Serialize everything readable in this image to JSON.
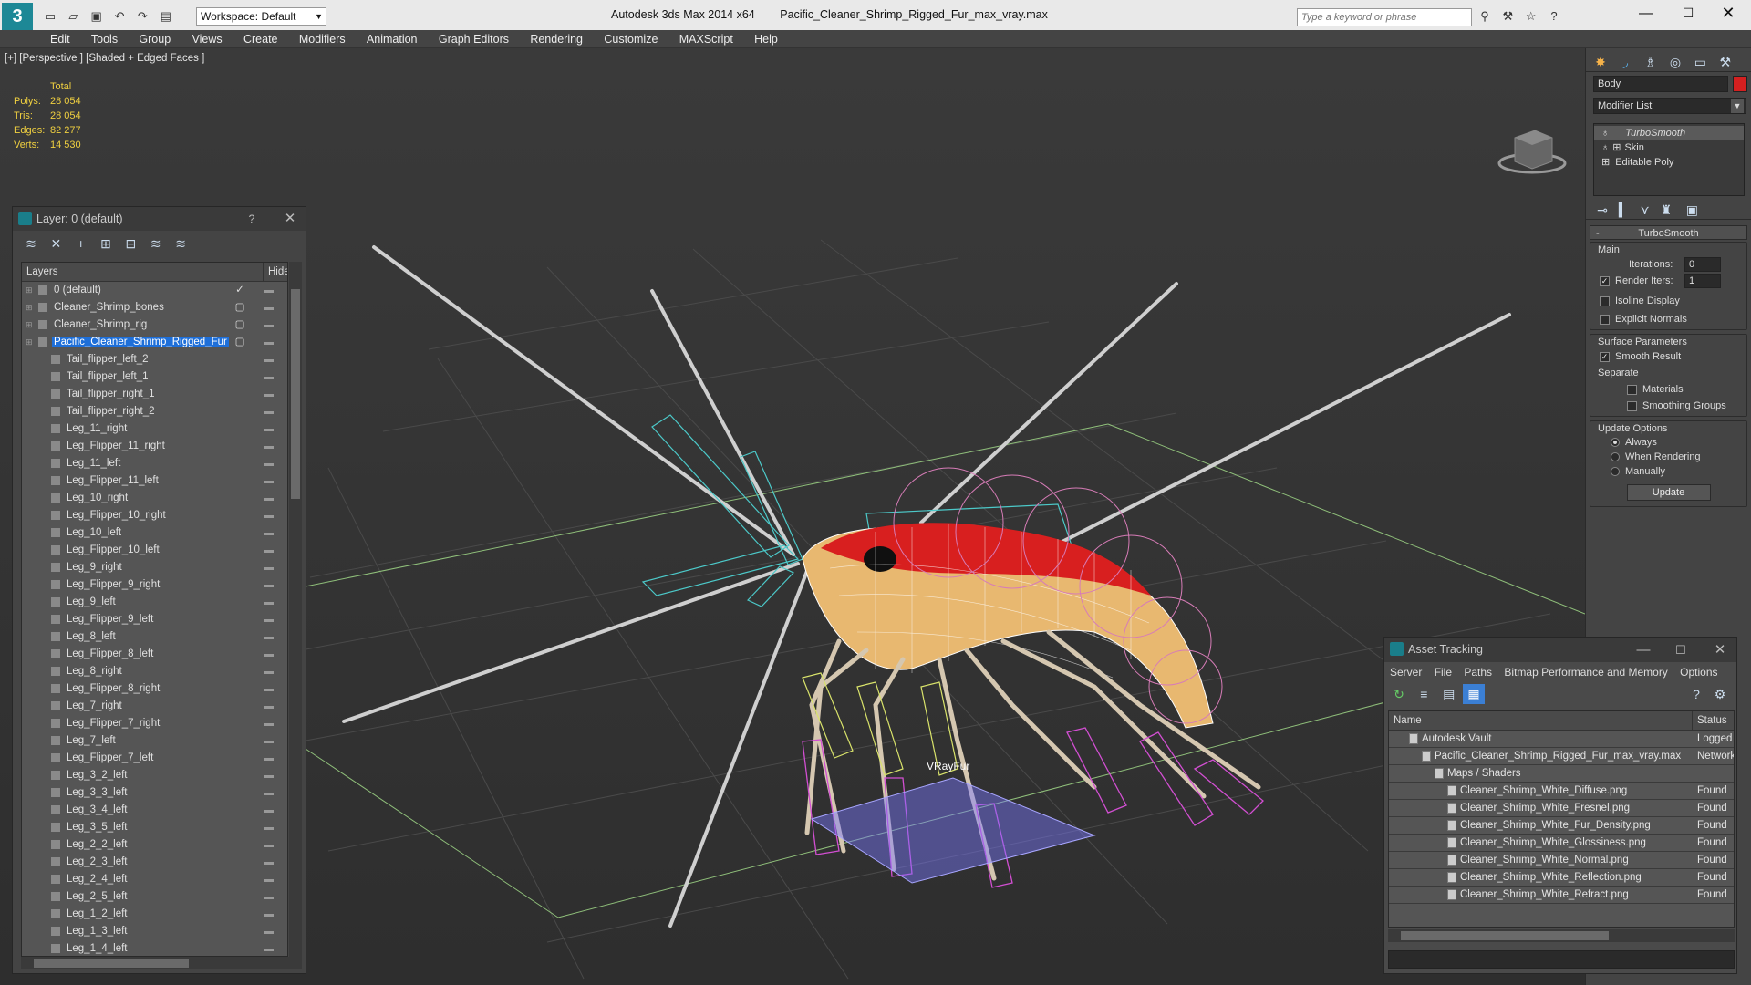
{
  "title_bar": {
    "workspace_label": "Workspace: Default",
    "app_title": "Autodesk 3ds Max  2014 x64",
    "file_title": "Pacific_Cleaner_Shrimp_Rigged_Fur_max_vray.max",
    "search_placeholder": "Type a keyword or phrase"
  },
  "menu": [
    "Edit",
    "Tools",
    "Group",
    "Views",
    "Create",
    "Modifiers",
    "Animation",
    "Graph Editors",
    "Rendering",
    "Customize",
    "MAXScript",
    "Help"
  ],
  "viewport": {
    "label": "[+] [Perspective ] [Shaded + Edged Faces ]",
    "stats_header": "Total",
    "stats": [
      {
        "label": "Polys:",
        "value": "28 054"
      },
      {
        "label": "Tris:",
        "value": "28 054"
      },
      {
        "label": "Edges:",
        "value": "82 277"
      },
      {
        "label": "Verts:",
        "value": "14 530"
      }
    ],
    "vrayfur_label": "VRayFur"
  },
  "layer_panel": {
    "title": "Layer: 0 (default)",
    "col_layers": "Layers",
    "col_hide": "Hide",
    "rows": [
      {
        "name": "0 (default)",
        "indent": 0,
        "hide": "✓",
        "selected": false
      },
      {
        "name": "Cleaner_Shrimp_bones",
        "indent": 0,
        "hide": "▢",
        "selected": false
      },
      {
        "name": "Cleaner_Shrimp_rig",
        "indent": 0,
        "hide": "▢",
        "selected": false
      },
      {
        "name": "Pacific_Cleaner_Shrimp_Rigged_Fur",
        "indent": 0,
        "hide": "▢",
        "selected": true
      },
      {
        "name": "Tail_flipper_left_2",
        "indent": 1,
        "hide": "",
        "selected": false
      },
      {
        "name": "Tail_flipper_left_1",
        "indent": 1,
        "hide": "",
        "selected": false
      },
      {
        "name": "Tail_flipper_right_1",
        "indent": 1,
        "hide": "",
        "selected": false
      },
      {
        "name": "Tail_flipper_right_2",
        "indent": 1,
        "hide": "",
        "selected": false
      },
      {
        "name": "Leg_11_right",
        "indent": 1,
        "hide": "",
        "selected": false
      },
      {
        "name": "Leg_Flipper_11_right",
        "indent": 1,
        "hide": "",
        "selected": false
      },
      {
        "name": "Leg_11_left",
        "indent": 1,
        "hide": "",
        "selected": false
      },
      {
        "name": "Leg_Flipper_11_left",
        "indent": 1,
        "hide": "",
        "selected": false
      },
      {
        "name": "Leg_10_right",
        "indent": 1,
        "hide": "",
        "selected": false
      },
      {
        "name": "Leg_Flipper_10_right",
        "indent": 1,
        "hide": "",
        "selected": false
      },
      {
        "name": "Leg_10_left",
        "indent": 1,
        "hide": "",
        "selected": false
      },
      {
        "name": "Leg_Flipper_10_left",
        "indent": 1,
        "hide": "",
        "selected": false
      },
      {
        "name": "Leg_9_right",
        "indent": 1,
        "hide": "",
        "selected": false
      },
      {
        "name": "Leg_Flipper_9_right",
        "indent": 1,
        "hide": "",
        "selected": false
      },
      {
        "name": "Leg_9_left",
        "indent": 1,
        "hide": "",
        "selected": false
      },
      {
        "name": "Leg_Flipper_9_left",
        "indent": 1,
        "hide": "",
        "selected": false
      },
      {
        "name": "Leg_8_left",
        "indent": 1,
        "hide": "",
        "selected": false
      },
      {
        "name": "Leg_Flipper_8_left",
        "indent": 1,
        "hide": "",
        "selected": false
      },
      {
        "name": "Leg_8_right",
        "indent": 1,
        "hide": "",
        "selected": false
      },
      {
        "name": "Leg_Flipper_8_right",
        "indent": 1,
        "hide": "",
        "selected": false
      },
      {
        "name": "Leg_7_right",
        "indent": 1,
        "hide": "",
        "selected": false
      },
      {
        "name": "Leg_Flipper_7_right",
        "indent": 1,
        "hide": "",
        "selected": false
      },
      {
        "name": "Leg_7_left",
        "indent": 1,
        "hide": "",
        "selected": false
      },
      {
        "name": "Leg_Flipper_7_left",
        "indent": 1,
        "hide": "",
        "selected": false
      },
      {
        "name": "Leg_3_2_left",
        "indent": 1,
        "hide": "",
        "selected": false
      },
      {
        "name": "Leg_3_3_left",
        "indent": 1,
        "hide": "",
        "selected": false
      },
      {
        "name": "Leg_3_4_left",
        "indent": 1,
        "hide": "",
        "selected": false
      },
      {
        "name": "Leg_3_5_left",
        "indent": 1,
        "hide": "",
        "selected": false
      },
      {
        "name": "Leg_2_2_left",
        "indent": 1,
        "hide": "",
        "selected": false
      },
      {
        "name": "Leg_2_3_left",
        "indent": 1,
        "hide": "",
        "selected": false
      },
      {
        "name": "Leg_2_4_left",
        "indent": 1,
        "hide": "",
        "selected": false
      },
      {
        "name": "Leg_2_5_left",
        "indent": 1,
        "hide": "",
        "selected": false
      },
      {
        "name": "Leg_1_2_left",
        "indent": 1,
        "hide": "",
        "selected": false
      },
      {
        "name": "Leg_1_3_left",
        "indent": 1,
        "hide": "",
        "selected": false
      },
      {
        "name": "Leg_1_4_left",
        "indent": 1,
        "hide": "",
        "selected": false
      }
    ]
  },
  "command_panel": {
    "object_name": "Body",
    "object_color": "#d42020",
    "modifier_list_label": "Modifier List",
    "stack": [
      "TurboSmooth",
      "Skin",
      "Editable Poly"
    ],
    "rollout_title": "TurboSmooth",
    "main_label": "Main",
    "iterations_label": "Iterations:",
    "iterations_value": "0",
    "render_iters_label": "Render Iters:",
    "render_iters_value": "1",
    "isoline_label": "Isoline Display",
    "explicit_normals_label": "Explicit Normals",
    "surface_params_label": "Surface Parameters",
    "smooth_result_label": "Smooth Result",
    "separate_label": "Separate",
    "materials_label": "Materials",
    "smoothing_groups_label": "Smoothing Groups",
    "update_options_label": "Update Options",
    "always_label": "Always",
    "when_rendering_label": "When Rendering",
    "manually_label": "Manually",
    "update_button": "Update"
  },
  "asset_tracking": {
    "title": "Asset Tracking",
    "menu": [
      "Server",
      "File",
      "Paths",
      "Bitmap Performance and Memory",
      "Options"
    ],
    "col_name": "Name",
    "col_status": "Status",
    "rows": [
      {
        "name": "Autodesk Vault",
        "status": "Logged O",
        "indent": 1
      },
      {
        "name": "Pacific_Cleaner_Shrimp_Rigged_Fur_max_vray.max",
        "status": "Network P",
        "indent": 2
      },
      {
        "name": "Maps / Shaders",
        "status": "",
        "indent": 3
      },
      {
        "name": "Cleaner_Shrimp_White_Diffuse.png",
        "status": "Found",
        "indent": 4
      },
      {
        "name": "Cleaner_Shrimp_White_Fresnel.png",
        "status": "Found",
        "indent": 4
      },
      {
        "name": "Cleaner_Shrimp_White_Fur_Density.png",
        "status": "Found",
        "indent": 4
      },
      {
        "name": "Cleaner_Shrimp_White_Glossiness.png",
        "status": "Found",
        "indent": 4
      },
      {
        "name": "Cleaner_Shrimp_White_Normal.png",
        "status": "Found",
        "indent": 4
      },
      {
        "name": "Cleaner_Shrimp_White_Reflection.png",
        "status": "Found",
        "indent": 4
      },
      {
        "name": "Cleaner_Shrimp_White_Refract.png",
        "status": "Found",
        "indent": 4
      }
    ]
  }
}
